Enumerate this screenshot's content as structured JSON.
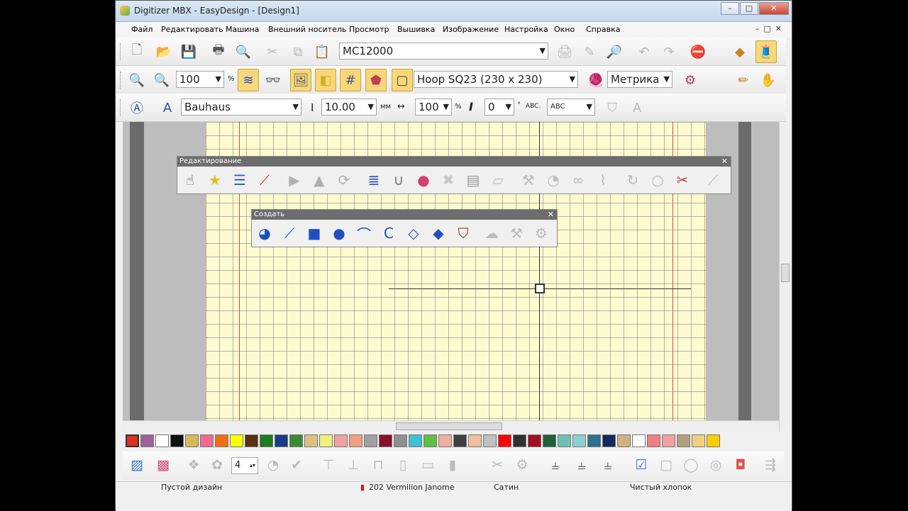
{
  "window": {
    "title": "Digitizer MBX - EasyDesign - [Design1]"
  },
  "menu": [
    "Файл",
    "Редактировать",
    "Машина",
    "Внешний носитель",
    "Просмотр",
    "Вышивка",
    "Изображение",
    "Настройка",
    "Окно",
    "Справка"
  ],
  "toolbar1": {
    "machine": "MC12000"
  },
  "toolbar2": {
    "zoom": "100",
    "zoom_unit": "%",
    "hoop": "Hoop SQ23 (230 x 230)",
    "units": "Метрика"
  },
  "toolbar3": {
    "font": "Bauhaus",
    "height": "10.00",
    "height_unit": "мм",
    "width": "100",
    "width_unit": "%",
    "italic_angle": "0",
    "angle_unit": "°",
    "spacing_label": "ABC.",
    "baseline_label": "ABC"
  },
  "palettes": {
    "edit": {
      "title": "Редактирование"
    },
    "create": {
      "title": "Создать"
    }
  },
  "bottom": {
    "count": "4"
  },
  "palette_colors": [
    "#e03020",
    "#a0609a",
    "#ffffff",
    "#101010",
    "#d7b85a",
    "#f06a90",
    "#f07010",
    "#ffff00",
    "#5a3010",
    "#207a20",
    "#1a3a8a",
    "#3a8a30",
    "#e0c080",
    "#f0f080",
    "#f0a0a0",
    "#f0a080",
    "#a0a0a0",
    "#8a1030",
    "#909090",
    "#40c0d0",
    "#60c040",
    "#f0b0a0",
    "#404040",
    "#f0c0a0",
    "#c0c0c0",
    "#ff0000",
    "#303030",
    "#a01020",
    "#206040",
    "#70c0b0",
    "#90d0d0",
    "#307090",
    "#102a60",
    "#d0b080",
    "#ffffff",
    "#f08080",
    "#f0a0a0",
    "#b0a080",
    "#f0d080",
    "#ffcc00"
  ],
  "status": {
    "design": "Пустой дизайн",
    "thread": "202 Vermilion Janome",
    "stitch": "Сатин",
    "fabric": "Чистый хлопок"
  }
}
